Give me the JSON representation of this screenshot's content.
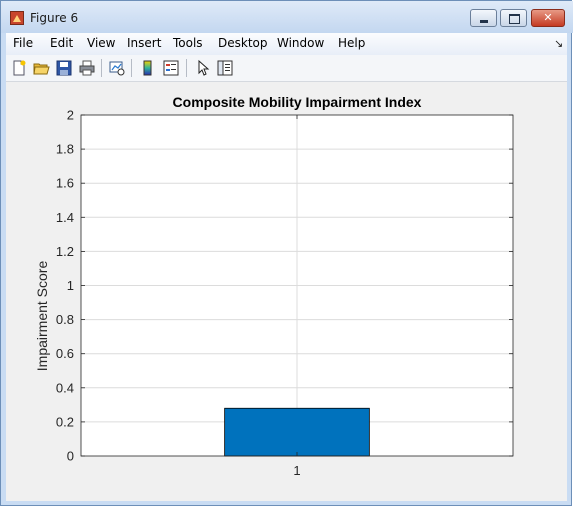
{
  "window": {
    "title": "Figure 6",
    "minimize_label": "_",
    "maximize_label": "□",
    "close_label": "✕"
  },
  "menu": {
    "items": [
      "File",
      "Edit",
      "View",
      "Insert",
      "Tools",
      "Desktop",
      "Window",
      "Help"
    ],
    "dock_arrow": "↘"
  },
  "toolbar": {
    "icons": [
      "new-figure-icon",
      "open-file-icon",
      "save-icon",
      "print-icon",
      "link-plot-icon",
      "colorbar-icon",
      "legend-icon",
      "pointer-icon",
      "property-editor-icon"
    ]
  },
  "colors": {
    "bar": "#0072BD",
    "axes_bg": "#ffffff",
    "grid": "#dcdcdc",
    "figure_bg": "#f0f0f0"
  },
  "chart_data": {
    "type": "bar",
    "title": "Composite Mobility Impairment Index",
    "xlabel": "",
    "ylabel": "Impairment Score",
    "categories": [
      "1"
    ],
    "values": [
      0.28
    ],
    "ylim": [
      0,
      2
    ],
    "yticks": [
      "0",
      "0.2",
      "0.4",
      "0.6",
      "0.8",
      "1",
      "1.2",
      "1.4",
      "1.6",
      "1.8",
      "2"
    ],
    "grid": true,
    "legend": "none"
  }
}
